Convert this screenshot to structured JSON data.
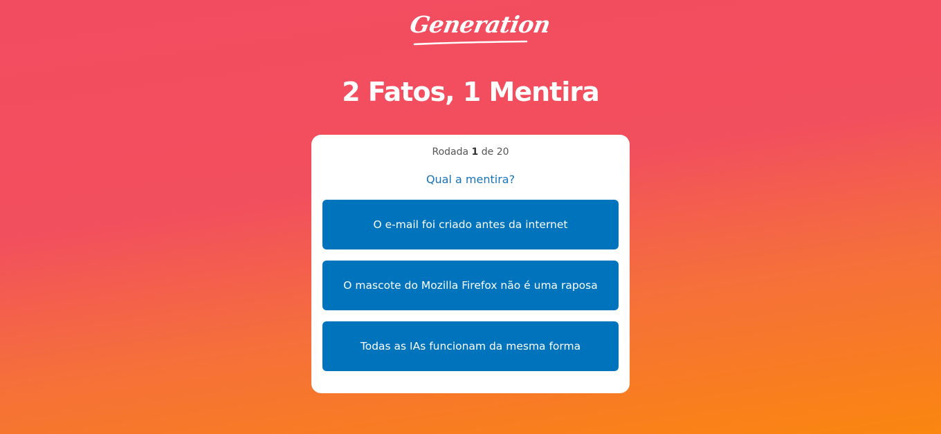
{
  "header": {
    "logo_text": "Generation",
    "title": "2 Fatos, 1 Mentira"
  },
  "game": {
    "round_prefix": "Rodada",
    "round_current": "1",
    "round_separator": "de",
    "round_total": "20",
    "question": "Qual a mentira?",
    "options": [
      "O e-mail foi criado antes da internet",
      "O mascote do Mozilla Firefox não é uma raposa",
      "Todas as IAs funcionam da mesma forma"
    ]
  },
  "colors": {
    "background_top": "#f24c60",
    "background_bottom": "#fb860f",
    "card": "#ffffff",
    "button": "#0073bd",
    "question_text": "#1773b8"
  }
}
